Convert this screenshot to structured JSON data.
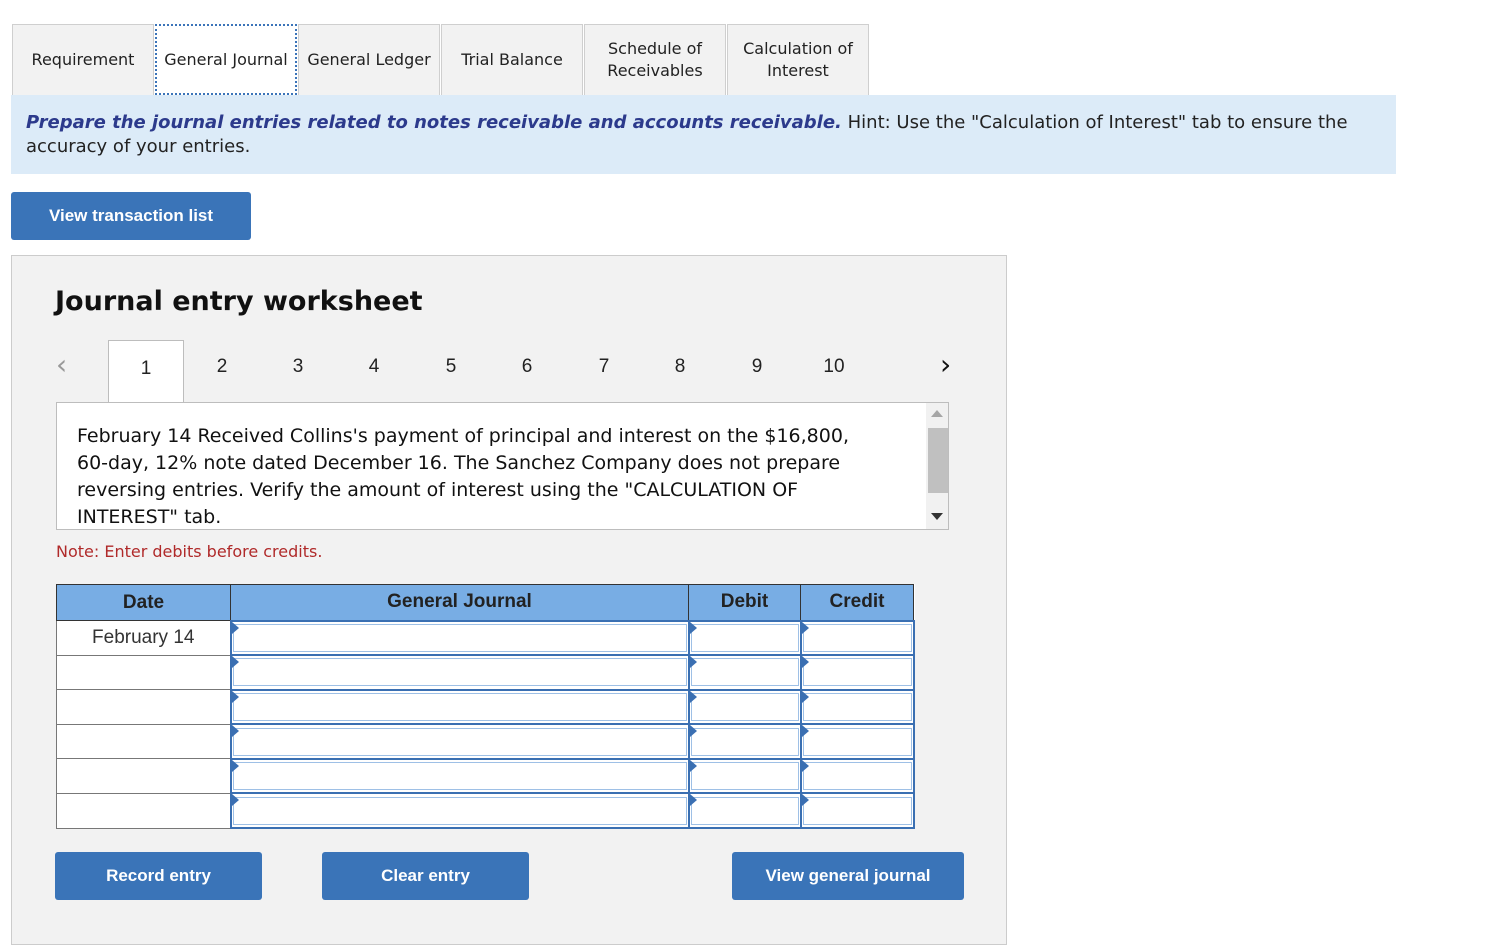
{
  "tabs": [
    {
      "label": "Requirement",
      "active": false
    },
    {
      "label": "General Journal",
      "active": true
    },
    {
      "label": "General Ledger",
      "active": false
    },
    {
      "label": "Trial Balance",
      "active": false
    },
    {
      "label": "Schedule of Receivables",
      "active": false
    },
    {
      "label": "Calculation of Interest",
      "active": false
    }
  ],
  "instructions": {
    "emphasis": "Prepare the journal entries related to notes receivable and accounts receivable.",
    "hint": " Hint:  Use the \"Calculation of Interest\" tab to ensure the accuracy of your entries."
  },
  "buttons": {
    "view_transactions": "View transaction list",
    "record_entry": "Record entry",
    "clear_entry": "Clear entry",
    "view_general_journal": "View general journal"
  },
  "worksheet": {
    "title": "Journal entry worksheet",
    "pages": [
      "1",
      "2",
      "3",
      "4",
      "5",
      "6",
      "7",
      "8",
      "9",
      "10"
    ],
    "active_page": "1",
    "prev_icon": "‹",
    "next_icon": "›",
    "description": "February 14 Received Collins's payment of principal and interest on the $16,800, 60-day, 12% note dated December 16. The Sanchez Company does not prepare reversing entries. Verify the amount of interest using the \"CALCULATION OF INTEREST\" tab.",
    "note": "Note: Enter debits before credits."
  },
  "journal_table": {
    "headers": {
      "date": "Date",
      "account": "General Journal",
      "debit": "Debit",
      "credit": "Credit"
    },
    "rows": [
      {
        "date": "February 14",
        "account": "",
        "debit": "",
        "credit": ""
      },
      {
        "date": "",
        "account": "",
        "debit": "",
        "credit": ""
      },
      {
        "date": "",
        "account": "",
        "debit": "",
        "credit": ""
      },
      {
        "date": "",
        "account": "",
        "debit": "",
        "credit": ""
      },
      {
        "date": "",
        "account": "",
        "debit": "",
        "credit": ""
      },
      {
        "date": "",
        "account": "",
        "debit": "",
        "credit": ""
      }
    ]
  }
}
